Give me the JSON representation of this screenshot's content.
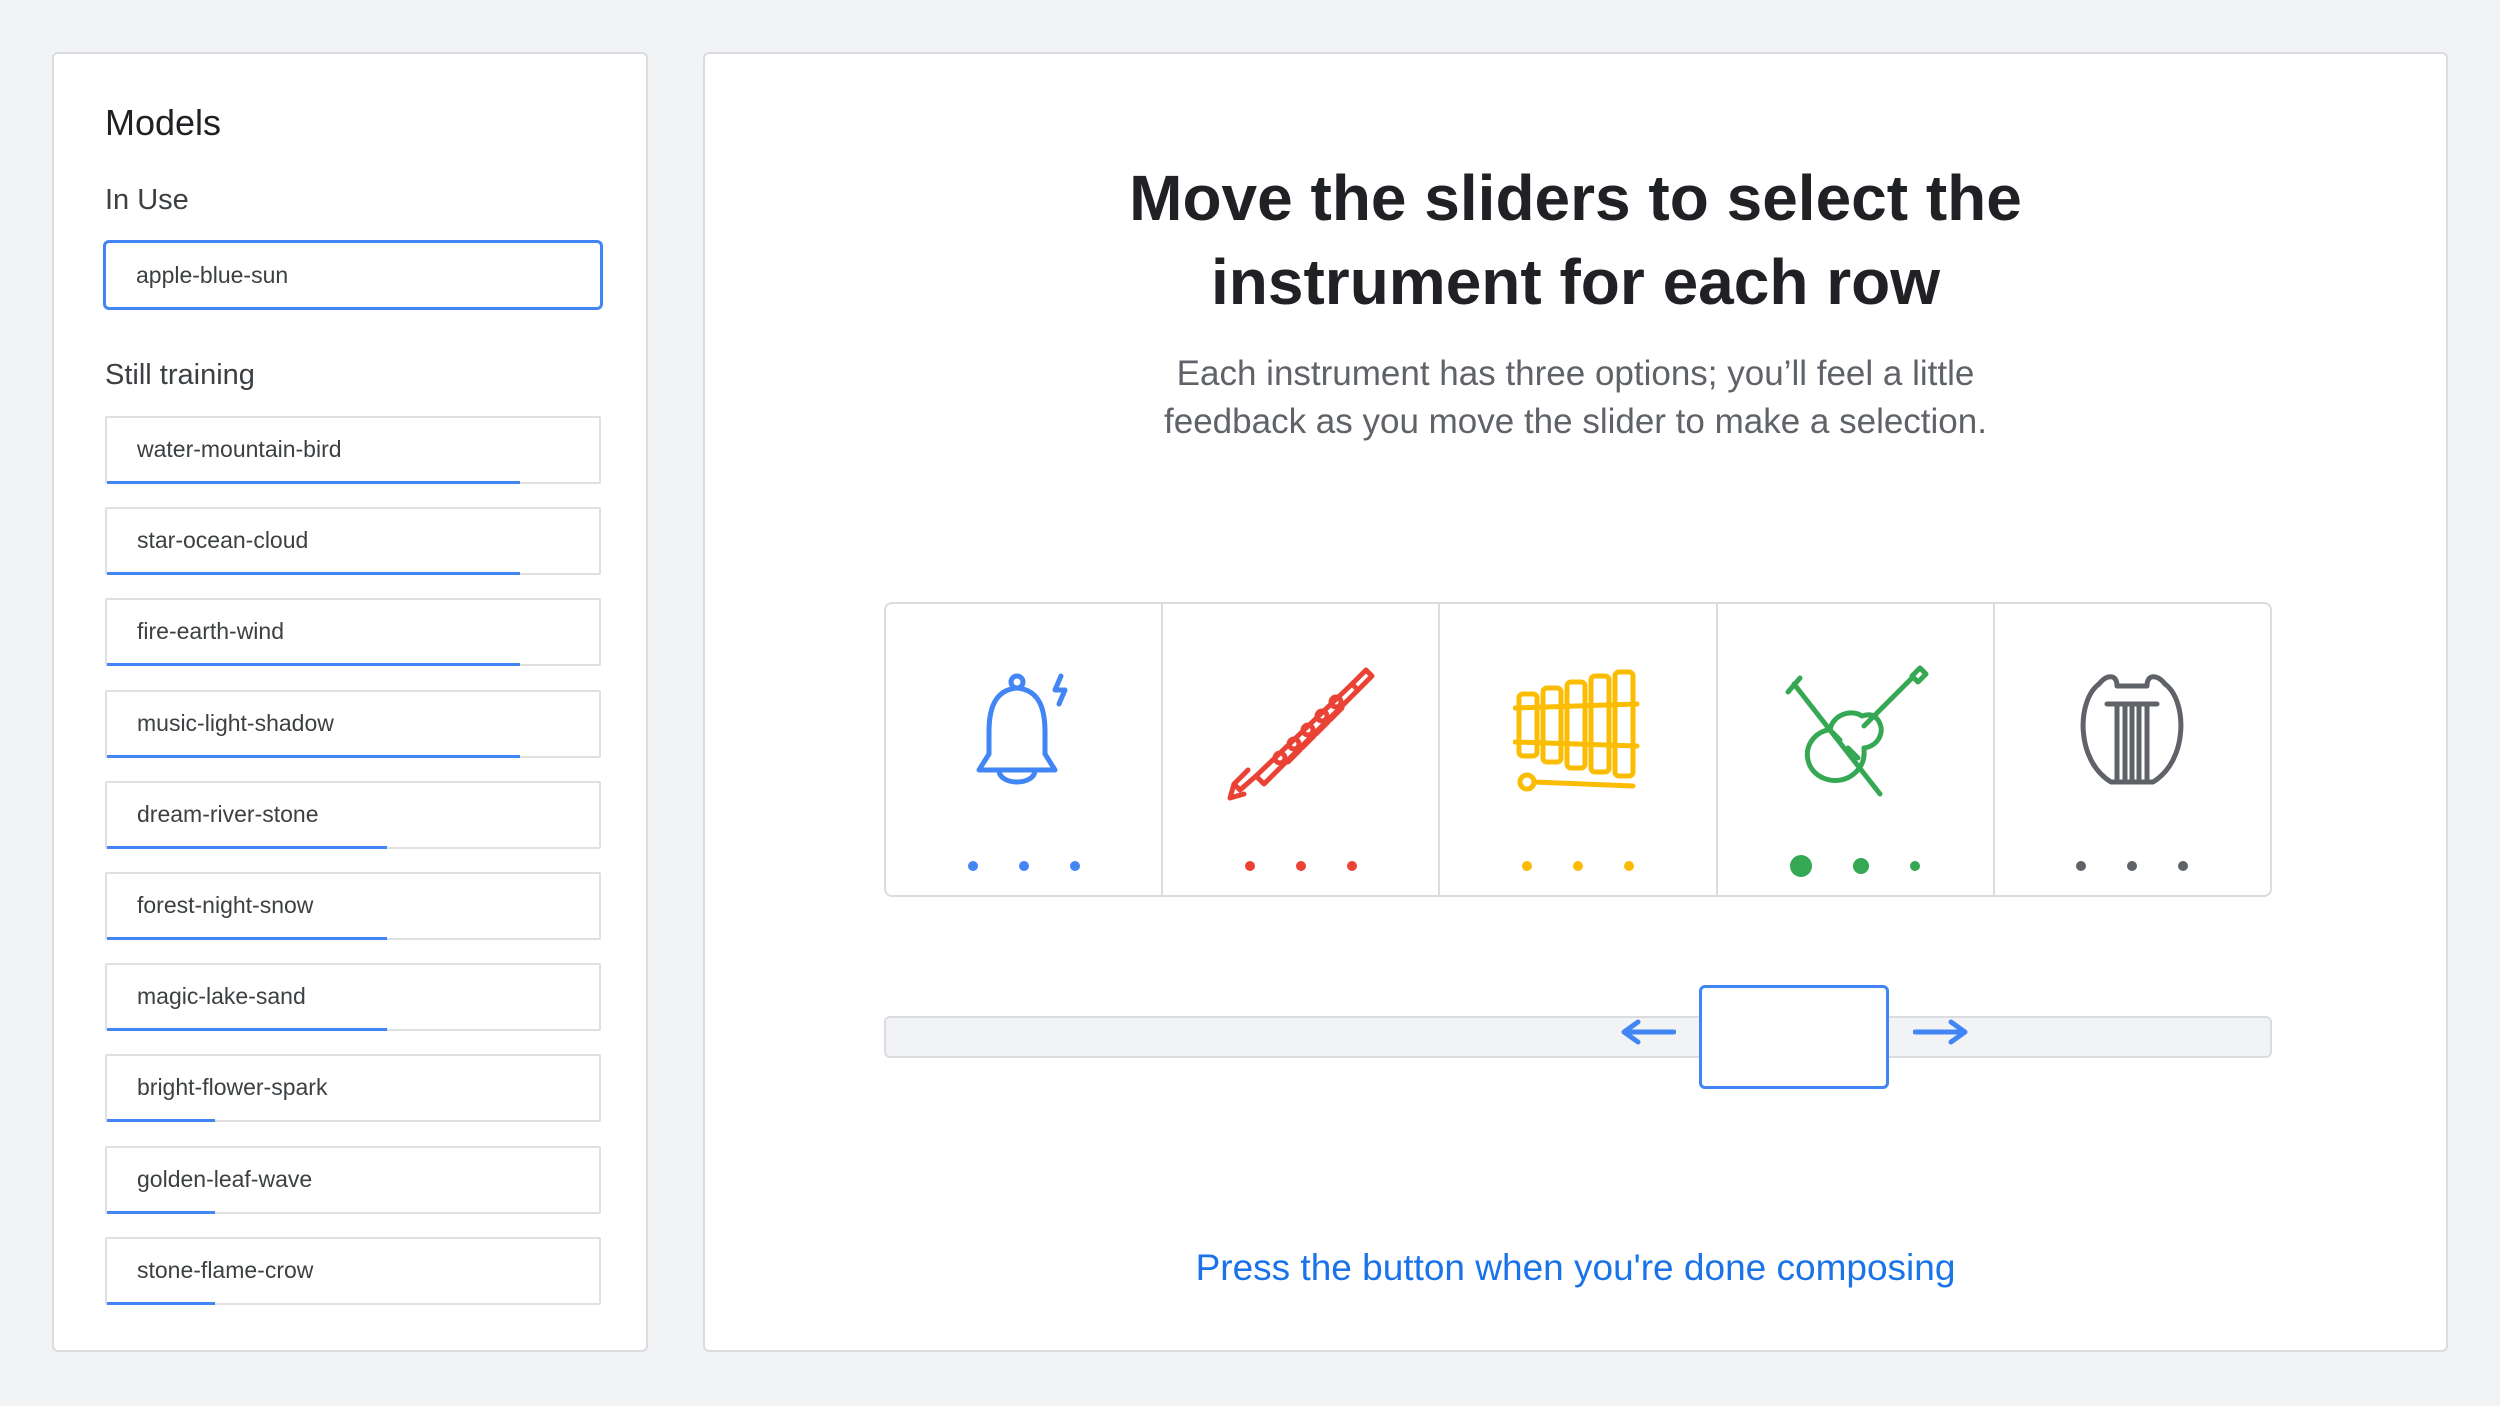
{
  "sidebar": {
    "title": "Models",
    "in_use_label": "In Use",
    "in_use_model": "apple-blue-sun",
    "still_training_label": "Still training",
    "training_models": [
      {
        "name": "water-mountain-bird",
        "progress": 0.84
      },
      {
        "name": "star-ocean-cloud",
        "progress": 0.84
      },
      {
        "name": "fire-earth-wind",
        "progress": 0.84
      },
      {
        "name": "music-light-shadow",
        "progress": 0.84
      },
      {
        "name": "dream-river-stone",
        "progress": 0.57
      },
      {
        "name": "forest-night-snow",
        "progress": 0.57
      },
      {
        "name": "magic-lake-sand",
        "progress": 0.57
      },
      {
        "name": "bright-flower-spark",
        "progress": 0.22
      },
      {
        "name": "golden-leaf-wave",
        "progress": 0.22
      },
      {
        "name": "stone-flame-crow",
        "progress": 0.22
      }
    ]
  },
  "main": {
    "heading_line1": "Move the sliders to select the",
    "heading_line2": "instrument for each row",
    "subheading_line1": "Each instrument has three options; you’ll feel a little",
    "subheading_line2": "feedback as you move the slider to make a selection.",
    "instruments": [
      {
        "icon": "bell-icon",
        "color": "#4285f4",
        "selected_option": null
      },
      {
        "icon": "clarinet-icon",
        "color": "#ea4335",
        "selected_option": null
      },
      {
        "icon": "xylophone-icon",
        "color": "#fbbc04",
        "selected_option": null
      },
      {
        "icon": "violin-icon",
        "color": "#34a853",
        "selected_option": 1
      },
      {
        "icon": "lyre-icon",
        "color": "#5f6368",
        "selected_option": null
      }
    ],
    "slider": {
      "arrow_left": "left-arrow-icon",
      "arrow_right": "right-arrow-icon",
      "accent": "#4285f4"
    },
    "done_link": "Press the button when you're done composing"
  }
}
